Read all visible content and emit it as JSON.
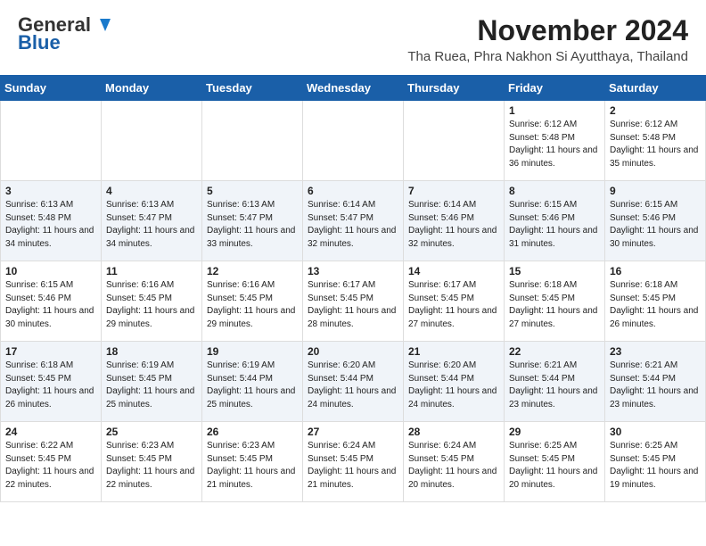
{
  "header": {
    "logo_general": "General",
    "logo_blue": "Blue",
    "month": "November 2024",
    "location": "Tha Ruea, Phra Nakhon Si Ayutthaya, Thailand"
  },
  "weekdays": [
    "Sunday",
    "Monday",
    "Tuesday",
    "Wednesday",
    "Thursday",
    "Friday",
    "Saturday"
  ],
  "weeks": [
    [
      {
        "day": "",
        "info": ""
      },
      {
        "day": "",
        "info": ""
      },
      {
        "day": "",
        "info": ""
      },
      {
        "day": "",
        "info": ""
      },
      {
        "day": "",
        "info": ""
      },
      {
        "day": "1",
        "info": "Sunrise: 6:12 AM\nSunset: 5:48 PM\nDaylight: 11 hours\nand 36 minutes."
      },
      {
        "day": "2",
        "info": "Sunrise: 6:12 AM\nSunset: 5:48 PM\nDaylight: 11 hours\nand 35 minutes."
      }
    ],
    [
      {
        "day": "3",
        "info": "Sunrise: 6:13 AM\nSunset: 5:48 PM\nDaylight: 11 hours\nand 34 minutes."
      },
      {
        "day": "4",
        "info": "Sunrise: 6:13 AM\nSunset: 5:47 PM\nDaylight: 11 hours\nand 34 minutes."
      },
      {
        "day": "5",
        "info": "Sunrise: 6:13 AM\nSunset: 5:47 PM\nDaylight: 11 hours\nand 33 minutes."
      },
      {
        "day": "6",
        "info": "Sunrise: 6:14 AM\nSunset: 5:47 PM\nDaylight: 11 hours\nand 32 minutes."
      },
      {
        "day": "7",
        "info": "Sunrise: 6:14 AM\nSunset: 5:46 PM\nDaylight: 11 hours\nand 32 minutes."
      },
      {
        "day": "8",
        "info": "Sunrise: 6:15 AM\nSunset: 5:46 PM\nDaylight: 11 hours\nand 31 minutes."
      },
      {
        "day": "9",
        "info": "Sunrise: 6:15 AM\nSunset: 5:46 PM\nDaylight: 11 hours\nand 30 minutes."
      }
    ],
    [
      {
        "day": "10",
        "info": "Sunrise: 6:15 AM\nSunset: 5:46 PM\nDaylight: 11 hours\nand 30 minutes."
      },
      {
        "day": "11",
        "info": "Sunrise: 6:16 AM\nSunset: 5:45 PM\nDaylight: 11 hours\nand 29 minutes."
      },
      {
        "day": "12",
        "info": "Sunrise: 6:16 AM\nSunset: 5:45 PM\nDaylight: 11 hours\nand 29 minutes."
      },
      {
        "day": "13",
        "info": "Sunrise: 6:17 AM\nSunset: 5:45 PM\nDaylight: 11 hours\nand 28 minutes."
      },
      {
        "day": "14",
        "info": "Sunrise: 6:17 AM\nSunset: 5:45 PM\nDaylight: 11 hours\nand 27 minutes."
      },
      {
        "day": "15",
        "info": "Sunrise: 6:18 AM\nSunset: 5:45 PM\nDaylight: 11 hours\nand 27 minutes."
      },
      {
        "day": "16",
        "info": "Sunrise: 6:18 AM\nSunset: 5:45 PM\nDaylight: 11 hours\nand 26 minutes."
      }
    ],
    [
      {
        "day": "17",
        "info": "Sunrise: 6:18 AM\nSunset: 5:45 PM\nDaylight: 11 hours\nand 26 minutes."
      },
      {
        "day": "18",
        "info": "Sunrise: 6:19 AM\nSunset: 5:45 PM\nDaylight: 11 hours\nand 25 minutes."
      },
      {
        "day": "19",
        "info": "Sunrise: 6:19 AM\nSunset: 5:44 PM\nDaylight: 11 hours\nand 25 minutes."
      },
      {
        "day": "20",
        "info": "Sunrise: 6:20 AM\nSunset: 5:44 PM\nDaylight: 11 hours\nand 24 minutes."
      },
      {
        "day": "21",
        "info": "Sunrise: 6:20 AM\nSunset: 5:44 PM\nDaylight: 11 hours\nand 24 minutes."
      },
      {
        "day": "22",
        "info": "Sunrise: 6:21 AM\nSunset: 5:44 PM\nDaylight: 11 hours\nand 23 minutes."
      },
      {
        "day": "23",
        "info": "Sunrise: 6:21 AM\nSunset: 5:44 PM\nDaylight: 11 hours\nand 23 minutes."
      }
    ],
    [
      {
        "day": "24",
        "info": "Sunrise: 6:22 AM\nSunset: 5:45 PM\nDaylight: 11 hours\nand 22 minutes."
      },
      {
        "day": "25",
        "info": "Sunrise: 6:23 AM\nSunset: 5:45 PM\nDaylight: 11 hours\nand 22 minutes."
      },
      {
        "day": "26",
        "info": "Sunrise: 6:23 AM\nSunset: 5:45 PM\nDaylight: 11 hours\nand 21 minutes."
      },
      {
        "day": "27",
        "info": "Sunrise: 6:24 AM\nSunset: 5:45 PM\nDaylight: 11 hours\nand 21 minutes."
      },
      {
        "day": "28",
        "info": "Sunrise: 6:24 AM\nSunset: 5:45 PM\nDaylight: 11 hours\nand 20 minutes."
      },
      {
        "day": "29",
        "info": "Sunrise: 6:25 AM\nSunset: 5:45 PM\nDaylight: 11 hours\nand 20 minutes."
      },
      {
        "day": "30",
        "info": "Sunrise: 6:25 AM\nSunset: 5:45 PM\nDaylight: 11 hours\nand 19 minutes."
      }
    ]
  ]
}
